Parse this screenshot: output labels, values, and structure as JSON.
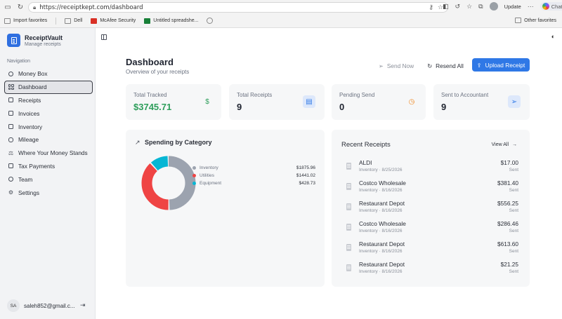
{
  "browser": {
    "url": "https://receiptkept.com/dashboard",
    "update_label": "Update",
    "chat_label": "Chat",
    "bookmarks": [
      {
        "label": "Import favorites",
        "icon": "import-icon"
      },
      {
        "label": "Dell",
        "icon": "folder-icon"
      },
      {
        "label": "McAfee Security",
        "icon": "mcafee-icon"
      },
      {
        "label": "Untitled spreadshe...",
        "icon": "sheets-icon"
      }
    ],
    "other_favorites": "Other favorites"
  },
  "app": {
    "name": "ReceiptVault",
    "tagline": "Manage receipts",
    "nav_title": "Navigation",
    "nav": [
      {
        "label": "Money Box",
        "icon": "piggy-icon"
      },
      {
        "label": "Dashboard",
        "icon": "grid-icon",
        "active": true
      },
      {
        "label": "Receipts",
        "icon": "receipt-icon"
      },
      {
        "label": "Invoices",
        "icon": "invoice-icon"
      },
      {
        "label": "Inventory",
        "icon": "box-icon"
      },
      {
        "label": "Mileage",
        "icon": "car-icon"
      },
      {
        "label": "Where Your Money Stands",
        "icon": "scale-icon"
      },
      {
        "label": "Tax Payments",
        "icon": "tax-icon"
      },
      {
        "label": "Team",
        "icon": "team-icon"
      },
      {
        "label": "Settings",
        "icon": "gear-icon"
      }
    ],
    "user": {
      "initials": "SA",
      "email": "saleh852@gmail.c..."
    }
  },
  "dashboard": {
    "title": "Dashboard",
    "subtitle": "Overview of your receipts",
    "send_now": "Send Now",
    "resend_all": "Resend All",
    "upload": "Upload Receipt",
    "stats": [
      {
        "label": "Total Tracked",
        "value": "$3745.71",
        "icon": "dollar-icon",
        "color": "#2e9e5b"
      },
      {
        "label": "Total Receipts",
        "value": "9",
        "icon": "receipt-icon",
        "color": "#2f78e6"
      },
      {
        "label": "Pending Send",
        "value": "0",
        "icon": "clock-icon",
        "color": "#f08a24"
      },
      {
        "label": "Sent to Accountant",
        "value": "9",
        "icon": "send-icon",
        "color": "#2f78e6"
      }
    ],
    "spending": {
      "title": "Spending by Category",
      "categories": [
        {
          "name": "Inventory",
          "amount": "$1875.96",
          "value": 1875.96,
          "color": "#9ca3af"
        },
        {
          "name": "Utilities",
          "amount": "$1441.02",
          "value": 1441.02,
          "color": "#ef4444"
        },
        {
          "name": "Equipment",
          "amount": "$428.73",
          "value": 428.73,
          "color": "#06b6d4"
        }
      ]
    },
    "recent": {
      "title": "Recent Receipts",
      "view_all": "View All",
      "items": [
        {
          "name": "ALDI",
          "meta": "Inventory · 8/25/2026",
          "amount": "$17.00",
          "status": "Sent"
        },
        {
          "name": "Costco Wholesale",
          "meta": "Inventory · 8/16/2026",
          "amount": "$381.40",
          "status": "Sent"
        },
        {
          "name": "Restaurant Depot",
          "meta": "Inventory · 8/16/2026",
          "amount": "$556.25",
          "status": "Sent"
        },
        {
          "name": "Costco Wholesale",
          "meta": "Inventory · 8/16/2026",
          "amount": "$286.46",
          "status": "Sent"
        },
        {
          "name": "Restaurant Depot",
          "meta": "Inventory · 8/16/2026",
          "amount": "$613.60",
          "status": "Sent"
        },
        {
          "name": "Restaurant Depot",
          "meta": "Inventory · 8/16/2026",
          "amount": "$21.25",
          "status": "Sent"
        }
      ]
    }
  }
}
